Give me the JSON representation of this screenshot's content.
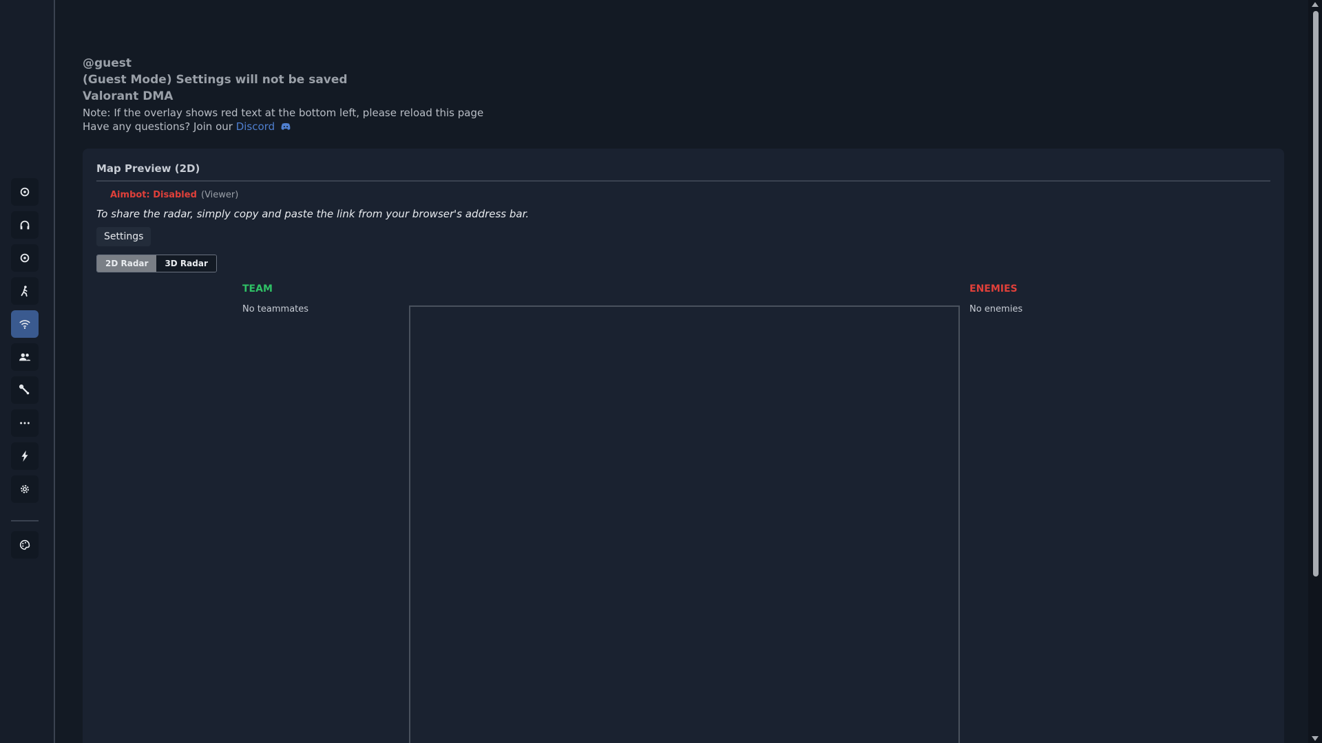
{
  "header": {
    "user": "@guest",
    "guest_notice": "(Guest Mode) Settings will not be saved",
    "product": "Valorant DMA",
    "note": "Note: If the overlay shows red text at the bottom left, please reload this page",
    "questions_prefix": "Have any questions? Join our",
    "discord_label": "Discord"
  },
  "sidebar": {
    "items": [
      {
        "icon": "crosshair-icon"
      },
      {
        "icon": "headphones-icon"
      },
      {
        "icon": "target-icon"
      },
      {
        "icon": "running-person-icon"
      },
      {
        "icon": "wifi-icon",
        "active": true
      },
      {
        "icon": "users-icon"
      },
      {
        "icon": "wrench-icon"
      },
      {
        "icon": "more-icon"
      },
      {
        "icon": "lightning-icon"
      },
      {
        "icon": "gear-icon"
      }
    ],
    "bottom": {
      "icon": "palette-icon"
    }
  },
  "panel": {
    "title": "Map Preview (2D)",
    "aimbot_status": "Aimbot: Disabled",
    "viewer_label": "(Viewer)",
    "share_text": "To share the radar, simply copy and paste the link from your browser's address bar.",
    "settings_label": "Settings",
    "radar_2d_label": "2D Radar",
    "radar_3d_label": "3D Radar",
    "team_title": "TEAM",
    "team_empty": "No teammates",
    "enemies_title": "ENEMIES",
    "enemies_empty": "No enemies"
  },
  "colors": {
    "accent": "#3a5a8f",
    "team": "#2fc065",
    "enemy": "#e0403a",
    "link": "#4f7fcf"
  }
}
